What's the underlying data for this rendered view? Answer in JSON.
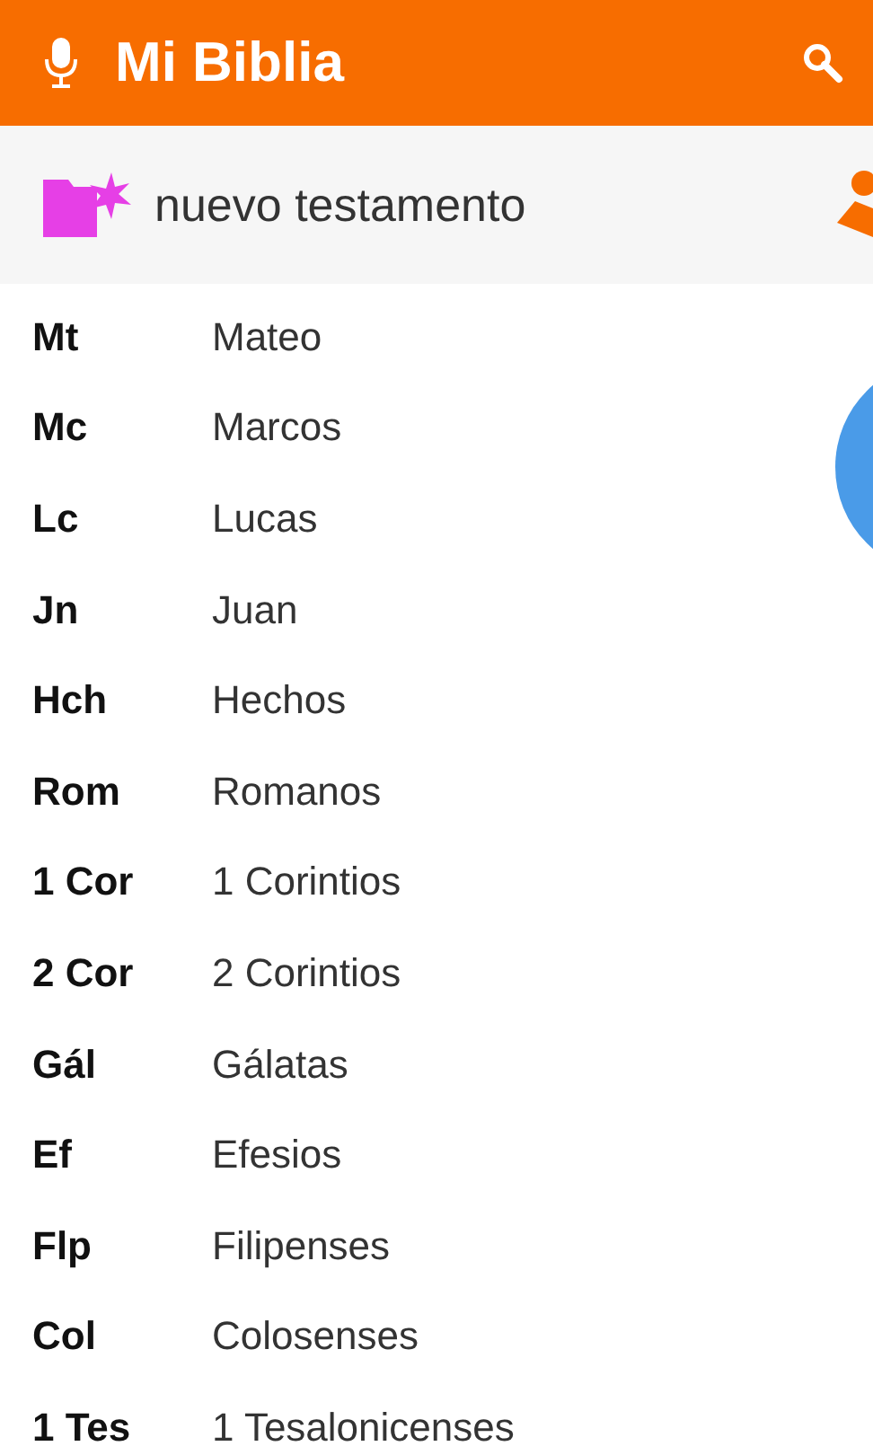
{
  "app_bar": {
    "title": "Mi Biblia"
  },
  "section": {
    "title": "nuevo testamento"
  },
  "books": [
    {
      "abbr": "Mt",
      "name": "Mateo"
    },
    {
      "abbr": "Mc",
      "name": "Marcos"
    },
    {
      "abbr": "Lc",
      "name": "Lucas"
    },
    {
      "abbr": "Jn",
      "name": "Juan"
    },
    {
      "abbr": "Hch",
      "name": "Hechos"
    },
    {
      "abbr": "Rom",
      "name": "Romanos"
    },
    {
      "abbr": "1 Cor",
      "name": "1 Corintios"
    },
    {
      "abbr": "2 Cor",
      "name": "2 Corintios"
    },
    {
      "abbr": "Gál",
      "name": "Gálatas"
    },
    {
      "abbr": "Ef",
      "name": "Efesios"
    },
    {
      "abbr": "Flp",
      "name": "Filipenses"
    },
    {
      "abbr": "Col",
      "name": "Colosenses"
    },
    {
      "abbr": "1 Tes",
      "name": "1 Tesalonicenses"
    }
  ]
}
